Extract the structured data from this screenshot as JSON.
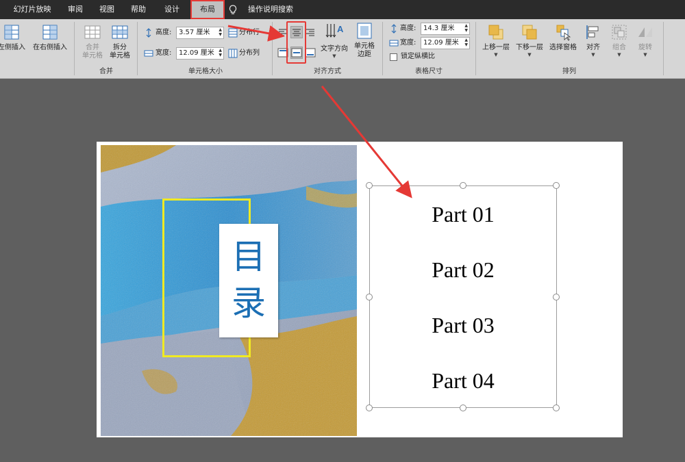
{
  "tabs": [
    {
      "key": "slideshow",
      "label": "幻灯片放映"
    },
    {
      "key": "review",
      "label": "审阅"
    },
    {
      "key": "view",
      "label": "视图"
    },
    {
      "key": "help",
      "label": "帮助"
    },
    {
      "key": "design",
      "label": "设计"
    },
    {
      "key": "layout",
      "label": "布局",
      "selected": true
    },
    {
      "key": "search",
      "label": "操作说明搜索"
    }
  ],
  "ribbon": {
    "rows_columns": {
      "insert_left_label": "左侧插入",
      "insert_right_label": "在右侧插入"
    },
    "merge": {
      "group_label": "合并",
      "merge_cells_label": [
        "合并",
        "单元格"
      ],
      "split_cells_label": [
        "拆分",
        "单元格"
      ]
    },
    "cell_size": {
      "group_label": "单元格大小",
      "height_label": "高度:",
      "height_value": "3.57 厘米",
      "width_label": "宽度:",
      "width_value": "12.09 厘米",
      "distribute_rows_label": "分布行",
      "distribute_cols_label": "分布列"
    },
    "alignment": {
      "group_label": "对齐方式",
      "text_direction_label": "文字方向",
      "cell_margins_label": [
        "单元格",
        "边距"
      ],
      "selected_horizontal": "center",
      "selected_vertical": "middle"
    },
    "table_size": {
      "group_label": "表格尺寸",
      "height_label": "高度:",
      "height_value": "14.3 厘米",
      "width_label": "宽度:",
      "width_value": "12.09 厘米",
      "lock_ratio_label": "锁定纵横比",
      "lock_ratio_checked": false
    },
    "arrange": {
      "group_label": "排列",
      "bring_forward_label": "上移一层",
      "send_backward_label": "下移一层",
      "selection_pane_label": "选择窗格",
      "align_label": "对齐",
      "group_btn_label": "组合",
      "rotate_label": "旋转"
    }
  },
  "slide": {
    "title_chars": [
      "目",
      "录"
    ],
    "parts": [
      "Part 01",
      "Part 02",
      "Part 03",
      "Part 04"
    ]
  },
  "colors": {
    "annotation_red": "#e53935",
    "title_blue": "#1c6fb4",
    "frame_yellow": "#f0ea22",
    "icon_blue": "#2f6fb5",
    "icon_gold": "#e8b84a"
  }
}
